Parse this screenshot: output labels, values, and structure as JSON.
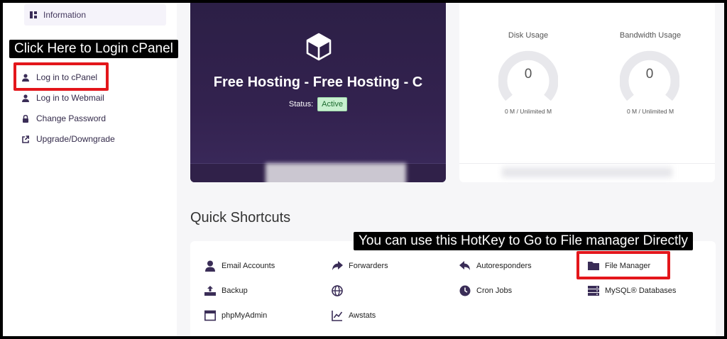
{
  "sidebar": {
    "info_label": "Information",
    "items": [
      {
        "label": "Log in to cPanel",
        "icon": "user-icon"
      },
      {
        "label": "Log in to Webmail",
        "icon": "user-icon"
      },
      {
        "label": "Change Password",
        "icon": "lock-icon"
      },
      {
        "label": "Upgrade/Downgrade",
        "icon": "external-link-icon"
      }
    ]
  },
  "callouts": {
    "login": "Click Here to Login cPanel",
    "hotkey": "You can use this HotKey to Go to File manager Directly"
  },
  "hosting": {
    "title": "Free Hosting - Free Hosting - C",
    "status_label": "Status:",
    "status_value": "Active"
  },
  "usage": {
    "disk": {
      "label": "Disk Usage",
      "value": "0",
      "detail": "0 M / Unlimited M"
    },
    "bandwidth": {
      "label": "Bandwidth Usage",
      "value": "0",
      "detail": "0 M / Unlimited M"
    }
  },
  "shortcuts": {
    "title": "Quick Shortcuts",
    "items": [
      {
        "label": "Email Accounts",
        "icon": "user-icon"
      },
      {
        "label": "Forwarders",
        "icon": "forward-arrow-icon"
      },
      {
        "label": "Autoresponders",
        "icon": "reply-arrow-icon"
      },
      {
        "label": "File Manager",
        "icon": "folder-icon"
      },
      {
        "label": "Backup",
        "icon": "backup-icon"
      },
      {
        "label": "",
        "icon": "globe-icon"
      },
      {
        "label": "Cron Jobs",
        "icon": "clock-icon"
      },
      {
        "label": "MySQL® Databases",
        "icon": "database-icon"
      },
      {
        "label": "phpMyAdmin",
        "icon": "window-icon"
      },
      {
        "label": "Awstats",
        "icon": "chart-line-icon"
      }
    ]
  },
  "colors": {
    "accent": "#2c1f46",
    "highlight": "#e3161b",
    "active_badge": "#c8f0cf"
  }
}
